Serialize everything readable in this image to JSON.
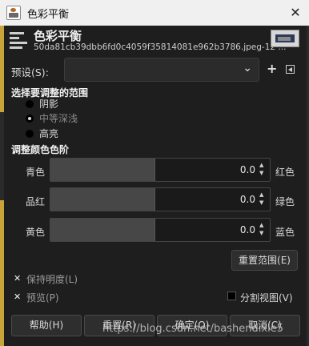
{
  "window": {
    "title": "色彩平衡",
    "close_glyph": "✕"
  },
  "header": {
    "title": "色彩平衡",
    "subtitle": "50da81cb39dbb6fd0c4059f35814081e962b3786.jpeg-12 ...",
    "icon": "color-balance-icon",
    "thumbnail": "image-thumbnail"
  },
  "preset": {
    "label": "预设(S):",
    "value": "",
    "add_glyph": "+",
    "menu_icon": "menu-arrow-icon"
  },
  "range": {
    "title": "选择要调整的范围",
    "options": [
      {
        "label": "阴影",
        "selected": false
      },
      {
        "label": "中等深浅",
        "selected": true
      },
      {
        "label": "高亮",
        "selected": false
      }
    ]
  },
  "levels": {
    "title": "调整颜色色阶",
    "rows": [
      {
        "left": "青色",
        "right": "红色",
        "value": "0.0"
      },
      {
        "left": "品红",
        "right": "绿色",
        "value": "0.0"
      },
      {
        "left": "黄色",
        "right": "蓝色",
        "value": "0.0"
      }
    ],
    "reset_range": "重置范围(E)"
  },
  "options": {
    "preserve": {
      "label": "保持明度(L)",
      "checked": true
    },
    "preview": {
      "label": "预览(P)",
      "checked": true
    },
    "split": {
      "label": "分割视图(V)",
      "checked": false
    }
  },
  "footer": {
    "help": "帮助(H)",
    "reset": "重置(R)",
    "ok": "确定(O)",
    "cancel": "取消(C)"
  },
  "watermark": "https://blog.csdn.net/bashendixie5",
  "colors": {
    "accent_edge": "#c9a23a",
    "background": "#1e1e1e"
  }
}
